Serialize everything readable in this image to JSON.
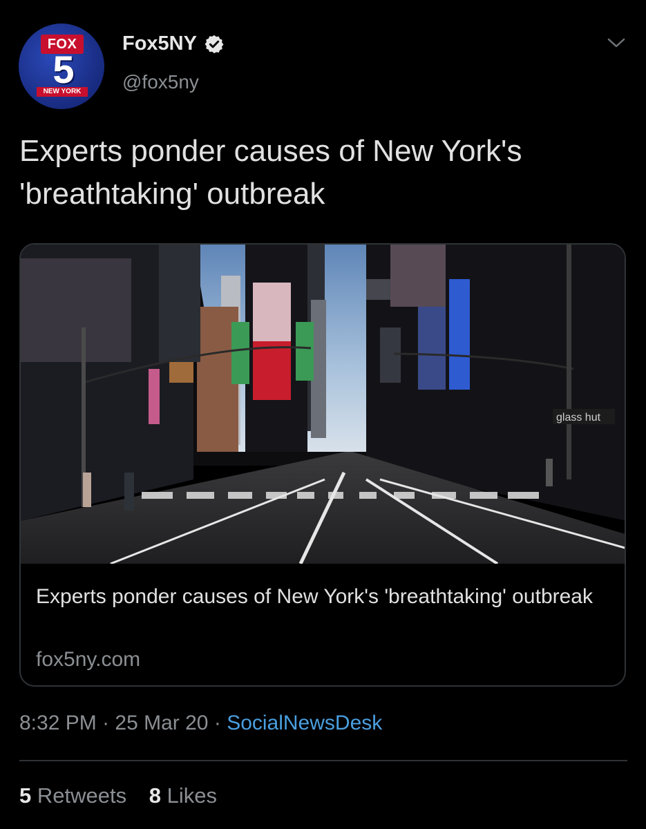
{
  "account": {
    "display_name": "Fox5NY",
    "handle": "@fox5ny",
    "verified": true,
    "avatar": {
      "logo_text": "FOX",
      "channel_number": "5",
      "market": "NEW YORK"
    }
  },
  "tweet": {
    "text": "Experts ponder causes of New York's 'breathtaking' outbreak"
  },
  "card": {
    "image_description_icon": "times-square-photo",
    "billboard_sign": "glass hut",
    "title": "Experts ponder causes of New York's 'breathtaking' outbreak",
    "domain": "fox5ny.com"
  },
  "meta": {
    "time": "8:32 PM",
    "separator": "·",
    "date": "25 Mar 20",
    "source": "SocialNewsDesk"
  },
  "stats": {
    "retweets_count": "5",
    "retweets_label": "Retweets",
    "likes_count": "8",
    "likes_label": "Likes"
  },
  "colors": {
    "background": "#000000",
    "text_primary": "#e1e1e1",
    "text_secondary": "#8b8f93",
    "link": "#4a9fe0",
    "border": "#2f3336",
    "fox_red": "#c8102e",
    "fox_blue": "#1b2f88"
  }
}
